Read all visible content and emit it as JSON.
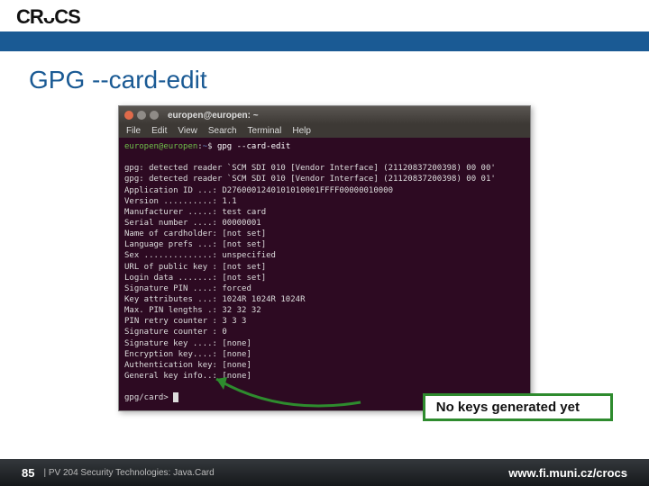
{
  "logo": "CRᴗCS",
  "slide_title": "GPG --card-edit",
  "terminal": {
    "title": "europen@europen: ~",
    "menu": [
      "File",
      "Edit",
      "View",
      "Search",
      "Terminal",
      "Help"
    ],
    "prompt_user": "europen@europen",
    "prompt_path": "~",
    "prompt_sep": ":",
    "prompt_sym": "$",
    "command": "gpg --card-edit",
    "lines": [
      "",
      "gpg: detected reader `SCM SDI 010 [Vendor Interface] (21120837200398) 00 00'",
      "gpg: detected reader `SCM SDI 010 [Vendor Interface] (21120837200398) 00 01'",
      "Application ID ...: D2760001240101010001FFFF00000010000",
      "Version ..........: 1.1",
      "Manufacturer .....: test card",
      "Serial number ....: 00000001",
      "Name of cardholder: [not set]",
      "Language prefs ...: [not set]",
      "Sex ..............: unspecified",
      "URL of public key : [not set]",
      "Login data .......: [not set]",
      "Signature PIN ....: forced",
      "Key attributes ...: 1024R 1024R 1024R",
      "Max. PIN lengths .: 32 32 32",
      "PIN retry counter : 3 3 3",
      "Signature counter : 0",
      "Signature key ....: [none]",
      "Encryption key....: [none]",
      "Authentication key: [none]",
      "General key info..: [none]",
      ""
    ],
    "final_prompt": "gpg/card>"
  },
  "callout": "No keys generated yet",
  "footer": {
    "num": "85",
    "text": "| PV 204 Security Technologies: Java.Card",
    "url": "www.fi.muni.cz/crocs"
  }
}
